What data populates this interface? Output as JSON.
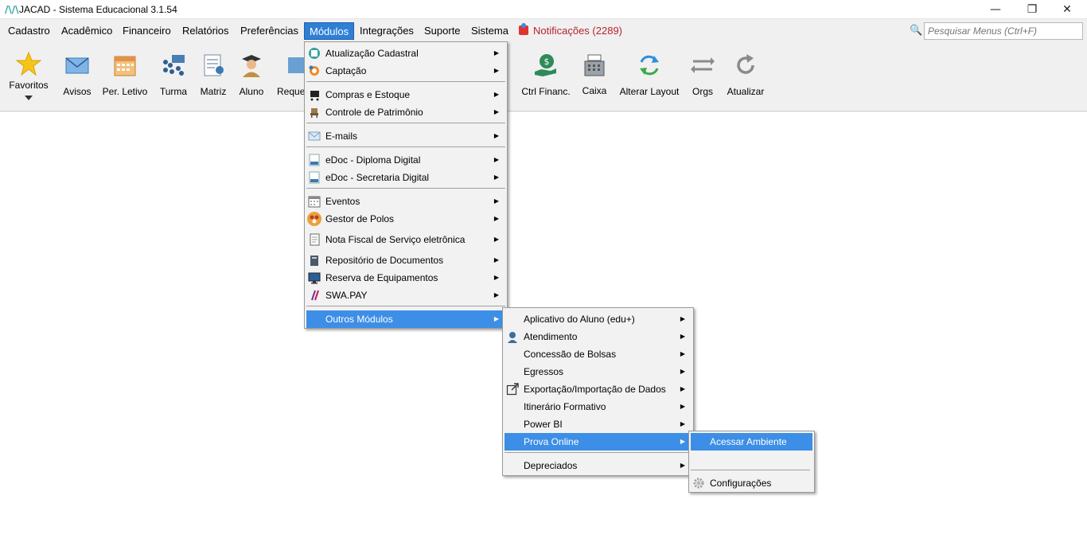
{
  "window": {
    "title": "JACAD - Sistema Educacional 3.1.54",
    "app_icon": "jacad-logo-icon",
    "controls": [
      "minimize-icon",
      "restore-icon",
      "close-icon"
    ]
  },
  "menubar": {
    "items": [
      "Cadastro",
      "Acadêmico",
      "Financeiro",
      "Relatórios",
      "Preferências",
      "Módulos",
      "Integrações",
      "Suporte",
      "Sistema"
    ],
    "active": "Módulos",
    "notifications": "Notificações (2289)"
  },
  "search": {
    "placeholder": "Pesquisar Menus (Ctrl+F)"
  },
  "toolbar": {
    "favoritos": "Favoritos",
    "avisos": "Avisos",
    "per_letivo": "Per. Letivo",
    "turma": "Turma",
    "matriz": "Matriz",
    "aluno": "Aluno",
    "requerimento": "Reque",
    "ctrl_financ": "Ctrl Financ.",
    "caixa": "Caixa",
    "alterar_layout": "Alterar Layout",
    "orgs": "Orgs",
    "atualizar": "Atualizar"
  },
  "modulos_menu": {
    "items": [
      "Atualização Cadastral",
      "Captação",
      "Compras e Estoque",
      "Controle de Patrimônio",
      "E-mails",
      "eDoc - Diploma Digital",
      "eDoc - Secretaria Digital",
      "Eventos",
      "Gestor de Polos",
      "Nota Fiscal de Serviço eletrônica",
      "Repositório de Documentos",
      "Reserva de Equipamentos",
      "SWA.PAY",
      "Outros Módulos"
    ]
  },
  "outros_menu": {
    "items": [
      "Aplicativo do Aluno (edu+)",
      "Atendimento",
      "Concessão de Bolsas",
      "Egressos",
      "Exportação/Importação de Dados",
      "Itinerário Formativo",
      "Power BI",
      "Prova Online",
      "Depreciados"
    ]
  },
  "prova_menu": {
    "items": [
      "Acessar Ambiente",
      "Configurações"
    ]
  },
  "colors": {
    "highlight": "#3d8ee6",
    "notification": "#b5232f",
    "active_menu": "#2f7fd6"
  }
}
